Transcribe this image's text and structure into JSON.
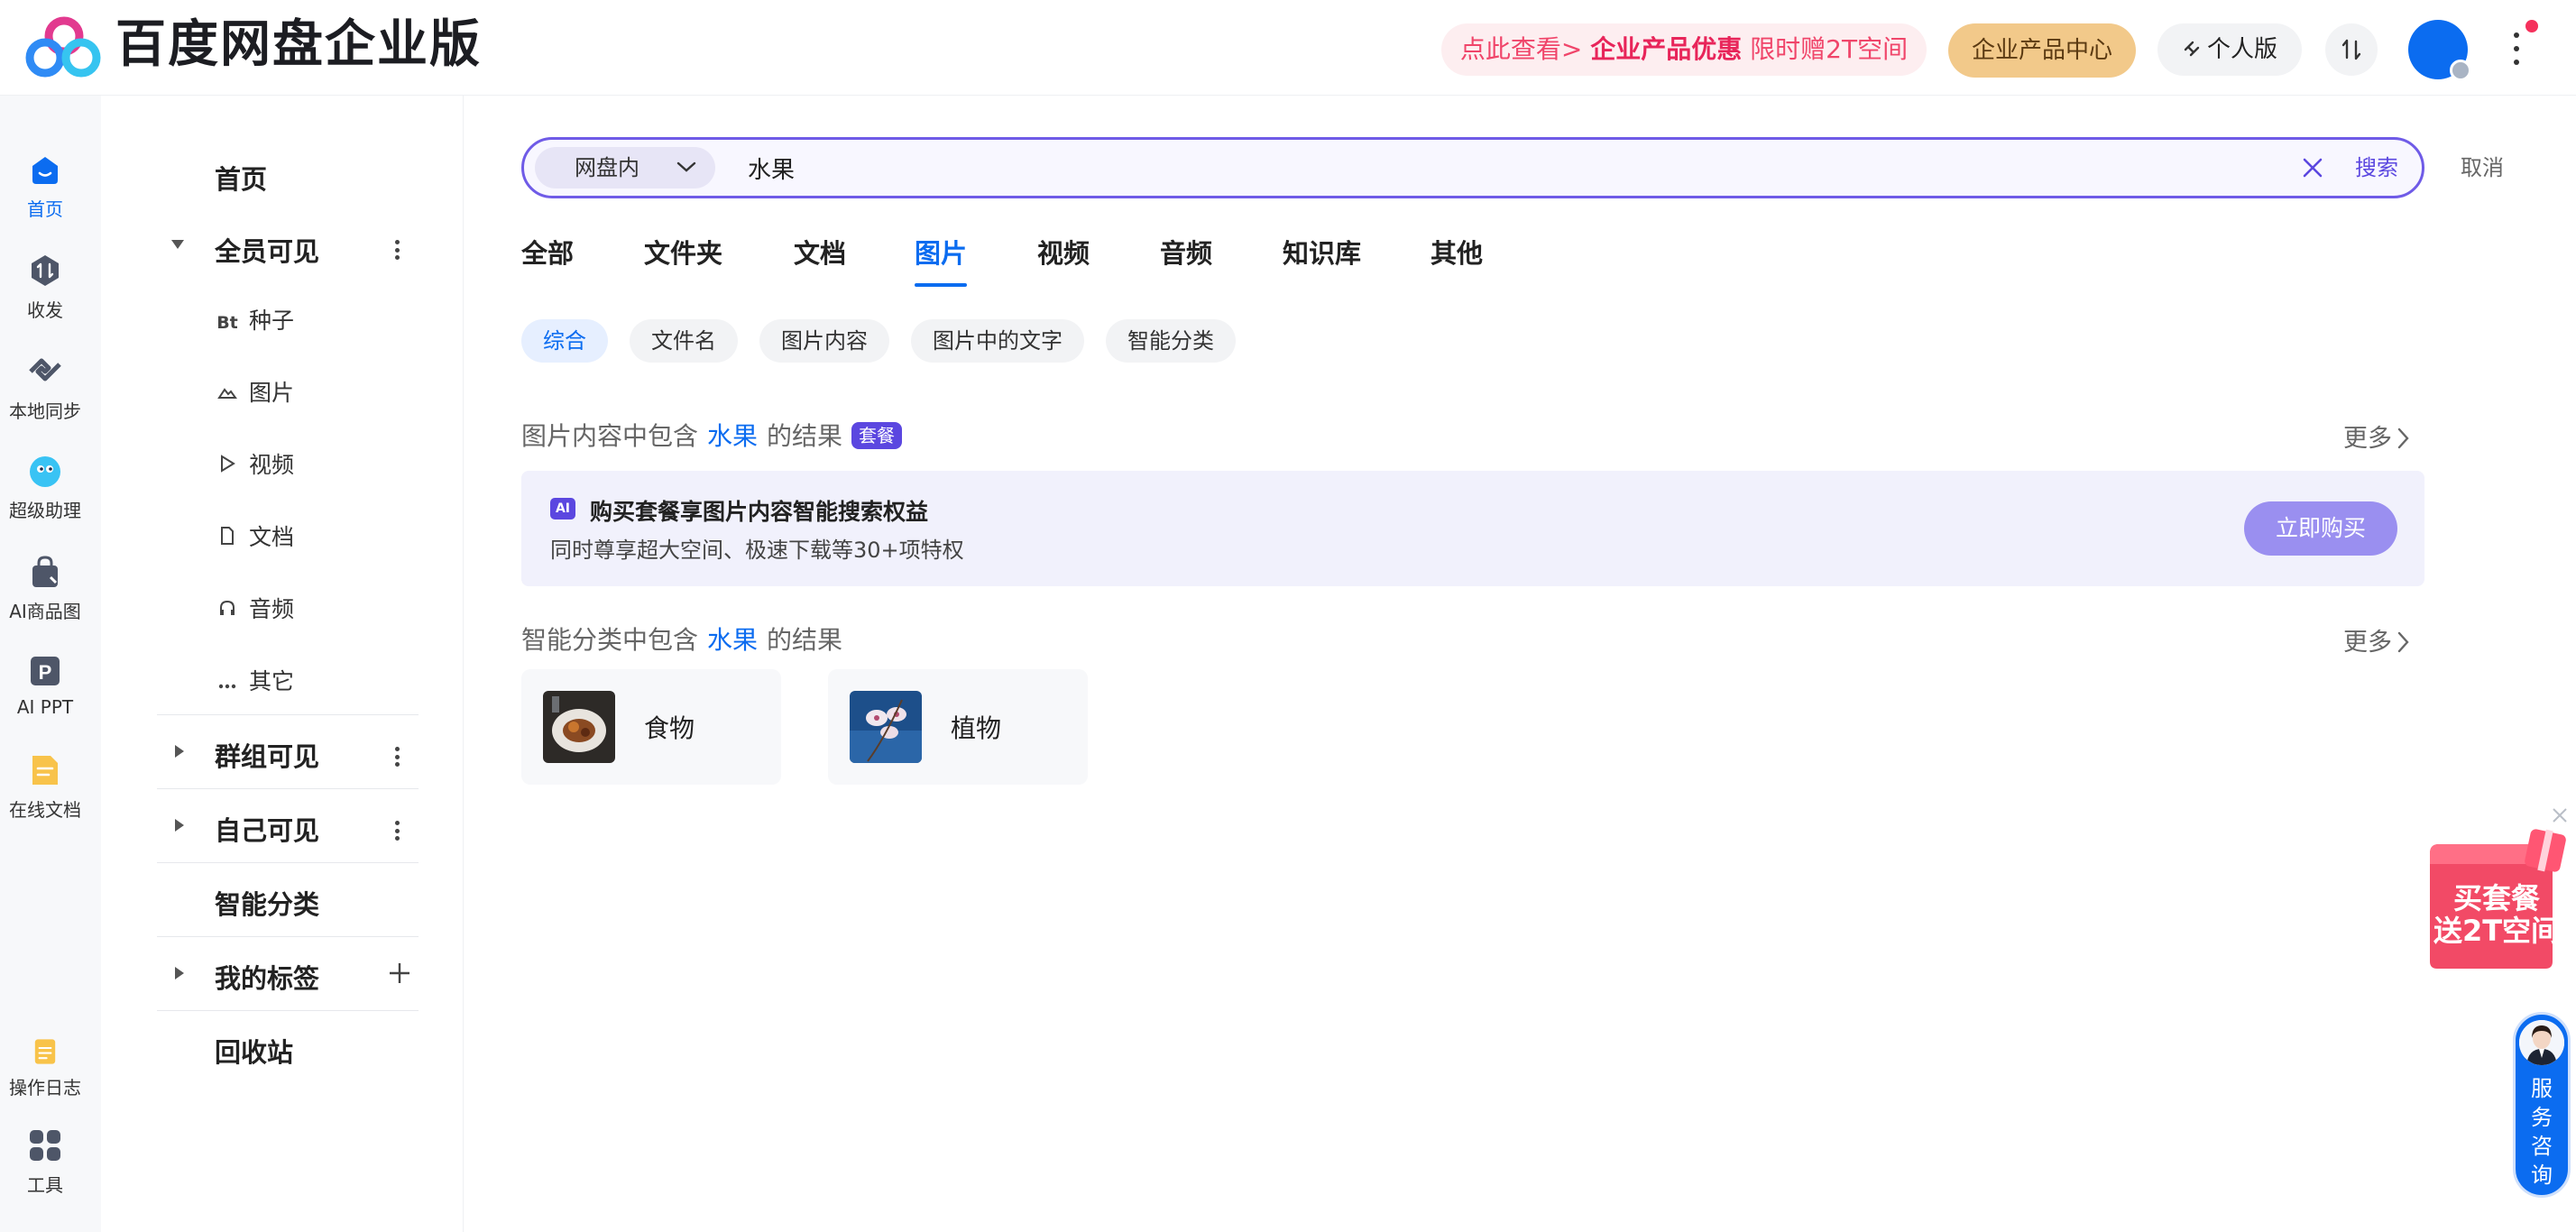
{
  "header": {
    "app_title": "百度网盘企业版",
    "promo": {
      "part1": "点此查看> ",
      "part2": "企业产品优惠",
      "part3": " 限时赠2T空间"
    },
    "enterprise_center": "企业产品中心",
    "personal_edition": "个人版",
    "transfer_label": "⇅"
  },
  "rail": {
    "items": [
      {
        "label": "首页",
        "icon": "home-icon",
        "active": true
      },
      {
        "label": "收发",
        "icon": "transfer-icon"
      },
      {
        "label": "本地同步",
        "icon": "sync-icon"
      },
      {
        "label": "超级助理",
        "icon": "assistant-icon"
      },
      {
        "label": "AI商品图",
        "icon": "ai-product-icon"
      },
      {
        "label": "AI PPT",
        "icon": "ai-ppt-icon"
      },
      {
        "label": "在线文档",
        "icon": "online-doc-icon"
      },
      {
        "label": "操作日志",
        "icon": "log-icon"
      },
      {
        "label": "工具",
        "icon": "tools-icon"
      }
    ]
  },
  "nav": {
    "home": "首页",
    "all_visible": "全员可见",
    "sub_items": [
      {
        "icon": "Bt",
        "label": "种子"
      },
      {
        "icon": "image-icon",
        "label": "图片"
      },
      {
        "icon": "play-icon",
        "label": "视频"
      },
      {
        "icon": "doc-icon",
        "label": "文档"
      },
      {
        "icon": "headphone-icon",
        "label": "音频"
      },
      {
        "icon": "more-icon",
        "label": "其它"
      }
    ],
    "group_visible": "群组可见",
    "self_visible": "自己可见",
    "smart_category": "智能分类",
    "my_tags": "我的标签",
    "recycle_bin": "回收站"
  },
  "search": {
    "scope": "网盘内",
    "query": "水果",
    "button": "搜索",
    "cancel": "取消"
  },
  "tabs": [
    "全部",
    "文件夹",
    "文档",
    "图片",
    "视频",
    "音频",
    "知识库",
    "其他"
  ],
  "active_tab": "图片",
  "filters": [
    "综合",
    "文件名",
    "图片内容",
    "图片中的文字",
    "智能分类"
  ],
  "active_filter": "综合",
  "section_content": {
    "prefix": "图片内容中包含",
    "keyword": "水果",
    "suffix": "的结果",
    "tag": "套餐",
    "more": "更多"
  },
  "banner": {
    "ai_icon": "AI",
    "title": "购买套餐享图片内容智能搜索权益",
    "subtitle": "同时尊享超大空间、极速下载等30+项特权",
    "button": "立即购买"
  },
  "section_category": {
    "prefix": "智能分类中包含",
    "keyword": "水果",
    "suffix": "的结果",
    "more": "更多",
    "cards": [
      {
        "name": "食物"
      },
      {
        "name": "植物"
      }
    ]
  },
  "float_promo": {
    "line1": "买套餐",
    "line2": "送2T空间"
  },
  "service": {
    "text": "服务咨询"
  },
  "colors": {
    "accent_blue": "#0b6cf0",
    "search_purple": "#6f5be7",
    "promo_pink": "#e8255a",
    "enterprise_gold": "#f2c98a"
  }
}
